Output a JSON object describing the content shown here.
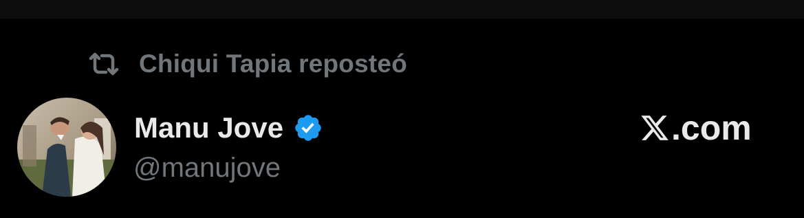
{
  "repost": {
    "icon": "repost-icon",
    "text": "Chiqui Tapia reposteó"
  },
  "author": {
    "avatar": "avatar-photo",
    "display_name": "Manu Jove",
    "verified_icon": "verified-badge-icon",
    "handle": "@manujove"
  },
  "brand": {
    "mark": "x-logo-icon",
    "text": ".com"
  },
  "colors": {
    "background": "#000000",
    "primary_text": "#e7e9ea",
    "secondary_text": "#71767b",
    "verified_blue": "#1d9bf0"
  }
}
